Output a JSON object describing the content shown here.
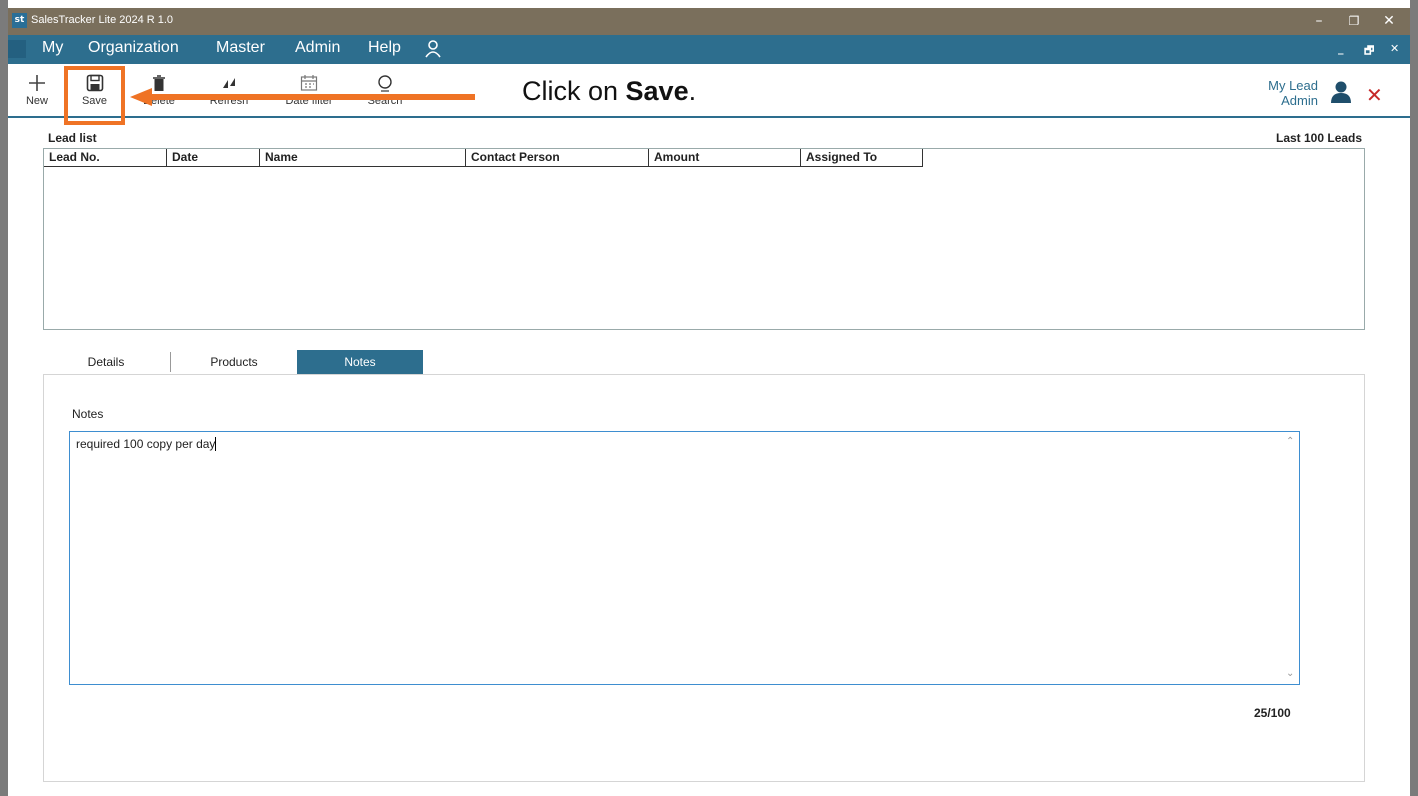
{
  "window": {
    "logo_text": "st",
    "title": "SalesTracker Lite 2024 R 1.0",
    "minimize": "–",
    "restore": "❐",
    "close": "✕"
  },
  "menubar": {
    "items": [
      "My",
      "Organization",
      "Master",
      "Admin",
      "Help"
    ],
    "mdi_minimize": "_",
    "mdi_restore": "🗗",
    "mdi_close": "✕"
  },
  "toolbar": {
    "new_label": "New",
    "save_label": "Save",
    "delete_label": "Delete",
    "refresh_label": "Refresh",
    "date_filter_label": "Date filter",
    "search_label": "Search",
    "module_title": "My Lead",
    "user_name": "Admin",
    "close_glyph": "✕"
  },
  "annotation": {
    "text_prefix": "Click on ",
    "text_bold": "Save",
    "text_suffix": ".",
    "highlight_color": "#ef7325"
  },
  "lead_list": {
    "label": "Lead list",
    "scope": "Last 100 Leads",
    "columns": [
      "Lead No.",
      "Date",
      "Name",
      "Contact Person",
      "Amount",
      "Assigned To"
    ],
    "rows": []
  },
  "tabs": {
    "items": [
      "Details",
      "Products",
      "Notes"
    ],
    "active": "Notes"
  },
  "notes": {
    "label": "Notes",
    "value": "required 100 copy per day",
    "counter": "25/100"
  },
  "colors": {
    "accent": "#2d6e8e",
    "titlebar": "#7a6f5c",
    "close_red": "#c62828"
  }
}
